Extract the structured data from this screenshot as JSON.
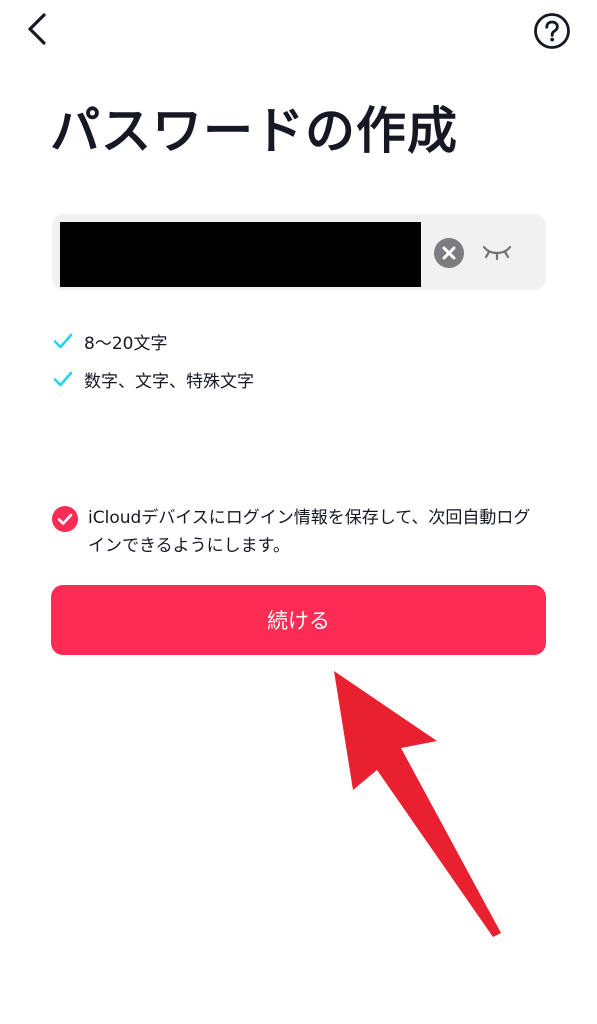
{
  "header": {
    "back_icon": "chevron-left-icon",
    "help_icon": "question-circle-icon"
  },
  "title": "パスワードの作成",
  "password": {
    "value": "",
    "masked": true,
    "clear_icon": "clear-x-circle-icon",
    "visibility_icon": "eye-closed-icon"
  },
  "rules": [
    {
      "label": "8〜20文字",
      "satisfied": true
    },
    {
      "label": "数字、文字、特殊文字",
      "satisfied": true
    }
  ],
  "save_login": {
    "checked": true,
    "text": "iCloudデバイスにログイン情報を保存して、次回自動ログインできるようにします。"
  },
  "continue_button": {
    "label": "続ける"
  },
  "colors": {
    "accent": "#fe2c55",
    "check": "#20d5ec",
    "field_bg": "#f1f1f2",
    "annotation_arrow": "#e8202f"
  }
}
